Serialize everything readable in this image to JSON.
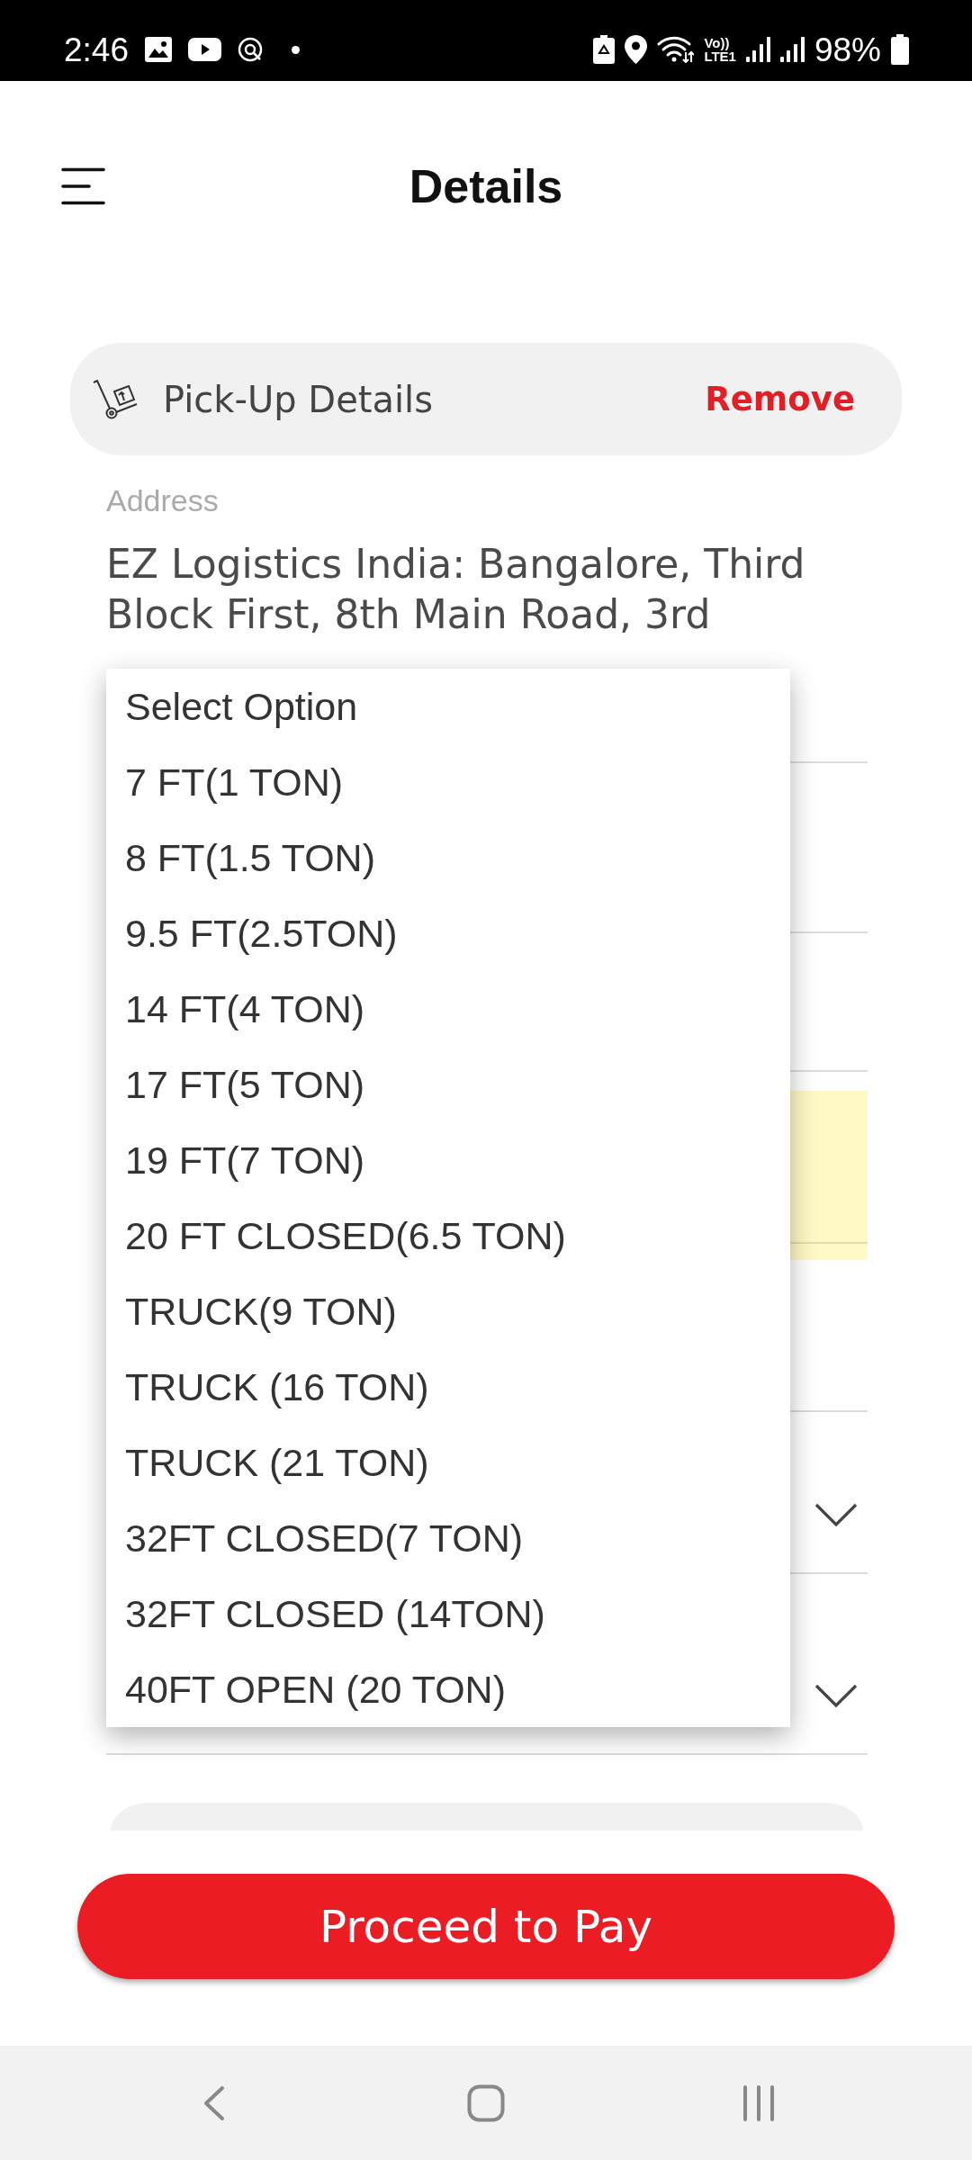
{
  "status_bar": {
    "time": "2:46",
    "network": {
      "top": "Vo))",
      "bottom": "LTE1"
    },
    "battery": "98%"
  },
  "header": {
    "title": "Details"
  },
  "pickup_card": {
    "title": "Pick-Up Details",
    "action": "Remove"
  },
  "address": {
    "label": "Address",
    "value": "EZ Logistics India: Bangalore, Third Block First, 8th Main Road, 3rd"
  },
  "fields": [
    {
      "kind": "text"
    },
    {
      "kind": "text"
    },
    {
      "kind": "note"
    },
    {
      "kind": "text"
    },
    {
      "kind": "select"
    },
    {
      "kind": "select"
    }
  ],
  "dropdown": {
    "options": [
      {
        "label": "Select Option",
        "selected": false
      },
      {
        "label": "7 FT(1 TON)",
        "selected": false
      },
      {
        "label": "8 FT(1.5 TON)",
        "selected": false
      },
      {
        "label": "9.5 FT(2.5TON)",
        "selected": false
      },
      {
        "label": "14 FT(4 TON)",
        "selected": false
      },
      {
        "label": "17 FT(5 TON)",
        "selected": false
      },
      {
        "label": "19 FT(7 TON)",
        "selected": false
      },
      {
        "label": "20 FT CLOSED(6.5 TON)",
        "selected": false
      },
      {
        "label": "TRUCK(9 TON)",
        "selected": false
      },
      {
        "label": "TRUCK (16 TON)",
        "selected": false
      },
      {
        "label": "TRUCK (21 TON)",
        "selected": false
      },
      {
        "label": "32FT CLOSED(7 TON)",
        "selected": false
      },
      {
        "label": "32FT CLOSED (14TON)",
        "selected": false
      },
      {
        "label": "40FT OPEN (20 TON)",
        "selected": false
      }
    ]
  },
  "footer": {
    "button": "Proceed to Pay"
  }
}
